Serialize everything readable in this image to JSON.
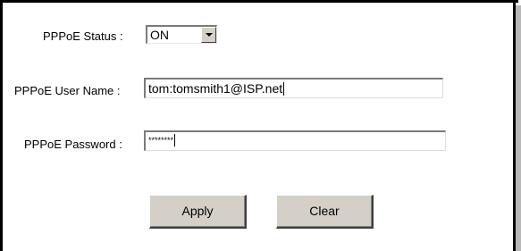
{
  "form": {
    "status_label": "PPPoE Status :",
    "status_value": "ON",
    "username_label": "PPPoE User Name :",
    "username_value": "tom:tomsmith1@ISP.net",
    "password_label": "PPPoE Password :",
    "password_value": "********"
  },
  "buttons": {
    "apply_label": "Apply",
    "clear_label": "Clear"
  }
}
